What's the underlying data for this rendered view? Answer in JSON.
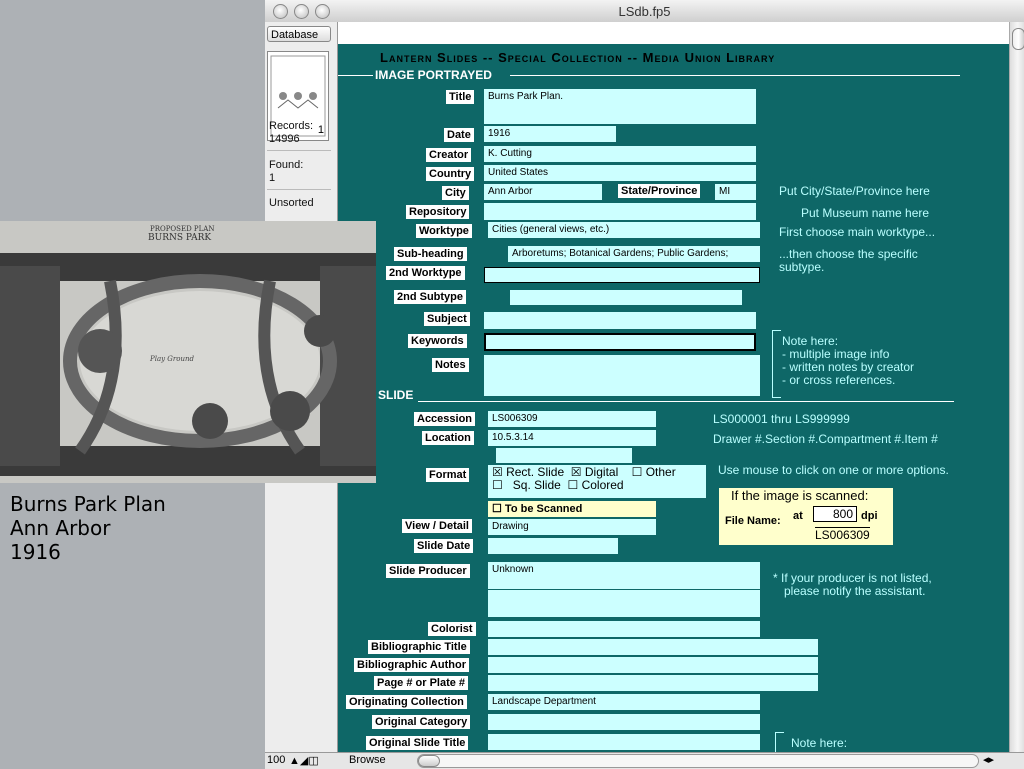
{
  "caption": {
    "line1": "Burns Park Plan",
    "line2": "Ann Arbor",
    "line3": "1916"
  },
  "photo": {
    "title": "PROPOSED PLAN",
    "subtitle": "BURNS PARK",
    "label_center": "Play Ground"
  },
  "window": {
    "title": "LSdb.fp5"
  },
  "status": {
    "database_label": "Database",
    "book_page": "1",
    "records_label": "Records:",
    "records_value": "14996",
    "found_label": "Found:",
    "found_value": "1",
    "sort_state": "Unsorted"
  },
  "bottom": {
    "zoom": "100",
    "mode": "Browse"
  },
  "layout": {
    "heading": "Lantern Slides -- Special Collection -- Media Union Library",
    "section_image": "IMAGE PORTRAYED",
    "section_slide": "SLIDE",
    "fields": {
      "title": {
        "label": "Title",
        "value": "Burns Park Plan."
      },
      "date": {
        "label": "Date",
        "value": "1916"
      },
      "creator": {
        "label": "Creator",
        "value": "K. Cutting"
      },
      "country": {
        "label": "Country",
        "value": "United States"
      },
      "city": {
        "label": "City",
        "value": "Ann Arbor"
      },
      "state": {
        "label": "State/Province",
        "value": "MI"
      },
      "repository": {
        "label": "Repository",
        "value": ""
      },
      "worktype": {
        "label": "Worktype",
        "value": "Cities (general views, etc.)"
      },
      "subheading": {
        "label": "Sub-heading",
        "value": "Arboretums; Botanical Gardens; Public Gardens;"
      },
      "worktype2": {
        "label": "2nd Worktype",
        "value": ""
      },
      "subtype2": {
        "label": "2nd Subtype",
        "value": ""
      },
      "subject": {
        "label": "Subject",
        "value": ""
      },
      "keywords": {
        "label": "Keywords",
        "value": ""
      },
      "notes": {
        "label": "Notes",
        "value": ""
      },
      "accession": {
        "label": "Accession",
        "value": "LS006309"
      },
      "location": {
        "label": "Location",
        "value": "10.5.3.14"
      },
      "format": {
        "label": "Format"
      },
      "view": {
        "label": "View / Detail",
        "value": "Drawing"
      },
      "slide_date": {
        "label": "Slide Date",
        "value": ""
      },
      "producer": {
        "label": "Slide Producer",
        "value": "Unknown"
      },
      "colorist": {
        "label": "Colorist",
        "value": ""
      },
      "bib_title": {
        "label": "Bibliographic Title",
        "value": ""
      },
      "bib_author": {
        "label": "Bibliographic Author",
        "value": ""
      },
      "page": {
        "label": "Page # or Plate #",
        "value": ""
      },
      "orig_collection": {
        "label": "Originating Collection",
        "value": "Landscape Department"
      },
      "orig_category": {
        "label": "Original Category",
        "value": ""
      },
      "orig_title": {
        "label": "Original Slide Title",
        "value": ""
      }
    },
    "format_options": {
      "rect": "Rect. Slide",
      "digital": "Digital",
      "other": "Other",
      "sq": "Sq. Slide",
      "colored": "Colored",
      "scanned": "To be Scanned"
    },
    "scan": {
      "heading": "If the image is scanned:",
      "file_label": "File Name:",
      "at": "at",
      "dpi_value": "800",
      "dpi": "dpi",
      "file_value": "LS006309"
    },
    "notes": {
      "city": "Put City/State/Province here",
      "museum": "Put Museum name here",
      "worktype": "First choose main worktype...",
      "subtype1": "...then choose the specific",
      "subtype2": "subtype.",
      "note_here": "Note here:",
      "multi": "- multiple image info",
      "written": "- written notes by creator",
      "cross": "- or cross references.",
      "accession": "LS000001 thru LS999999",
      "location": "Drawer #.Section #.Compartment #.Item #",
      "mouse": "Use mouse to click on one or more options.",
      "producer1": "* If your producer is not listed,",
      "producer2": "please notify the assistant.",
      "note_here2": "Note here:"
    }
  }
}
